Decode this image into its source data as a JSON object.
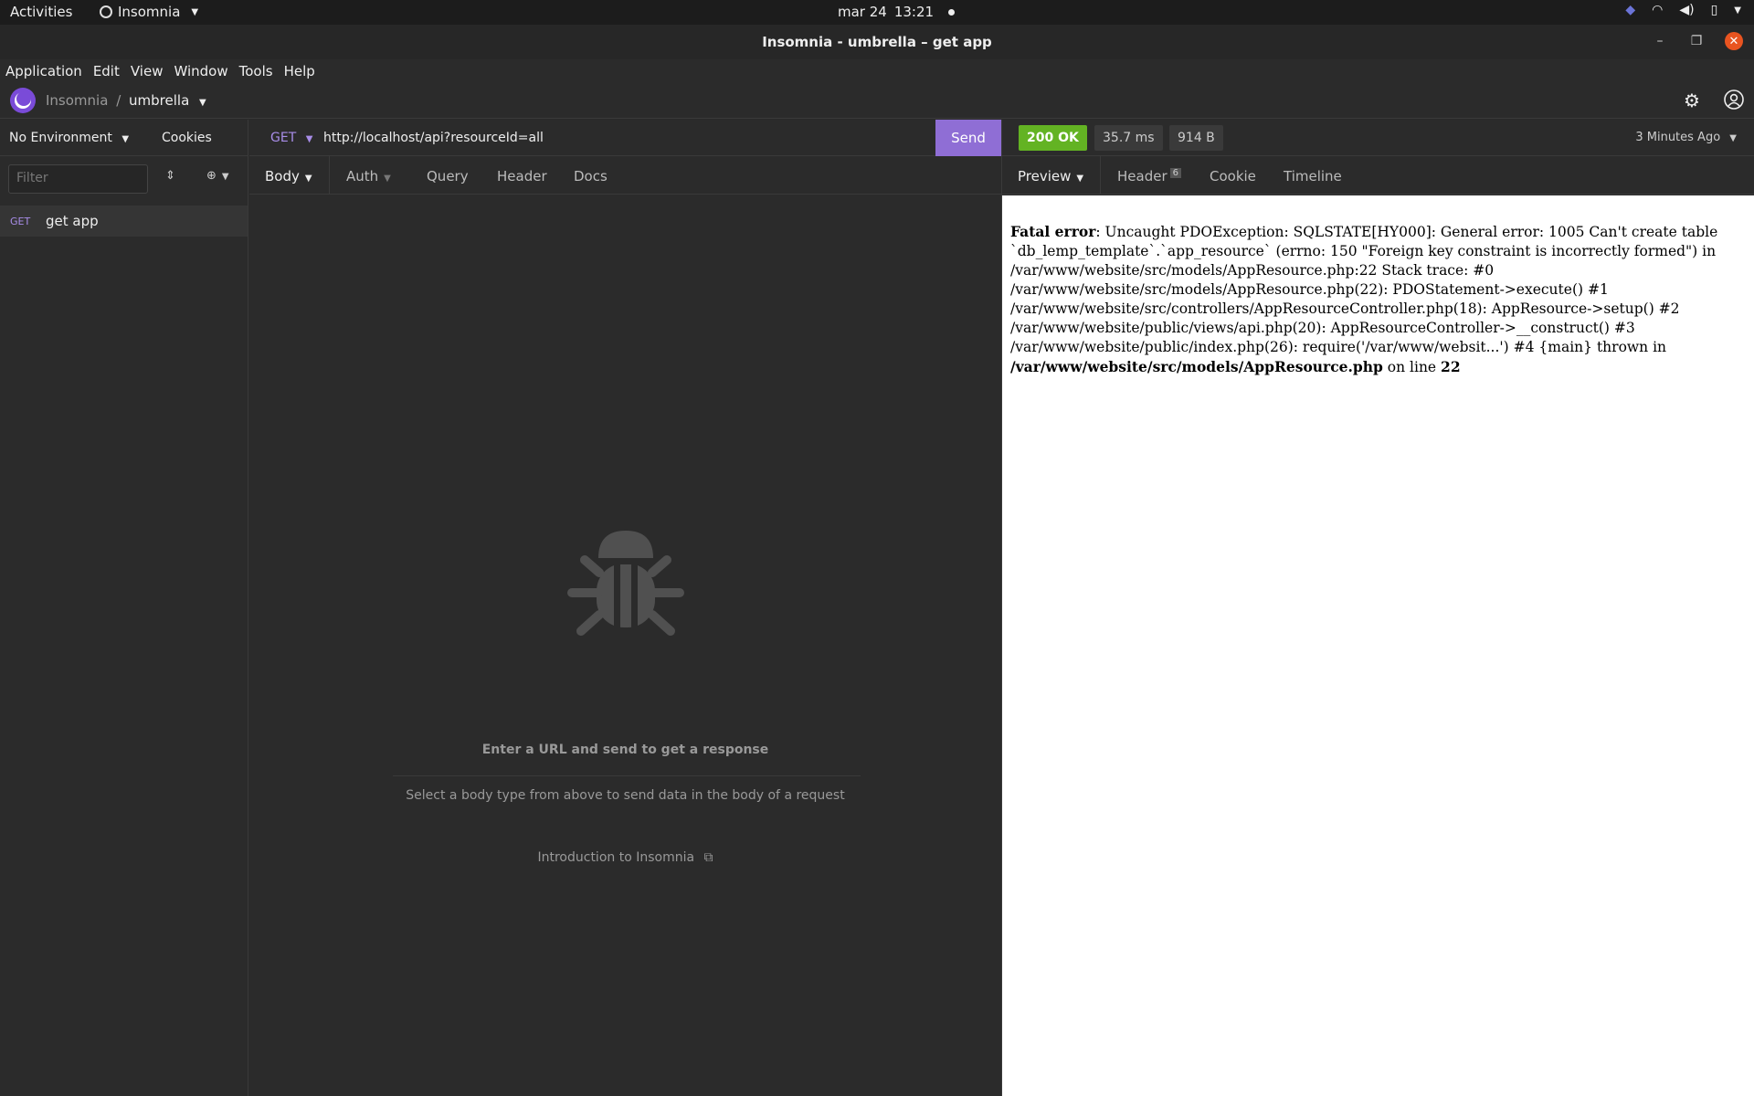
{
  "system_bar": {
    "activities": "Activities",
    "app_name": "Insomnia",
    "date": "mar 24",
    "time": "13:21"
  },
  "window": {
    "title": "Insomnia - umbrella – get app"
  },
  "menu": {
    "items": [
      "Application",
      "Edit",
      "View",
      "Window",
      "Tools",
      "Help"
    ]
  },
  "header": {
    "crumb_root": "Insomnia",
    "crumb_sep": "/",
    "crumb_current": "umbrella"
  },
  "sidebar": {
    "environment": "No Environment",
    "cookies": "Cookies",
    "filter_placeholder": "Filter",
    "requests": [
      {
        "method": "GET",
        "name": "get app"
      }
    ]
  },
  "request": {
    "method": "GET",
    "url": "http://localhost/api?resourceId=all",
    "send_label": "Send",
    "tabs": [
      "Body",
      "Auth",
      "Query",
      "Header",
      "Docs"
    ],
    "empty_title": "Enter a URL and send to get a response",
    "empty_subtitle": "Select a body type from above to send data in the body of a request",
    "intro_link": "Introduction to Insomnia"
  },
  "response": {
    "status": "200 OK",
    "time": "35.7 ms",
    "size": "914 B",
    "age": "3 Minutes Ago",
    "tabs": [
      "Preview",
      "Header",
      "Cookie",
      "Timeline"
    ],
    "header_count": "6",
    "error_label": "Fatal error",
    "error_message": ": Uncaught PDOException: SQLSTATE[HY000]: General error: 1005 Can't create table `db_lemp_template`.`app_resource` (errno: 150 \"Foreign key constraint is incorrectly formed\") in /var/www/website/src/models/AppResource.php:22 Stack trace: #0 /var/www/website/src/models/AppResource.php(22): PDOStatement->execute() #1 /var/www/website/src/controllers/AppResourceController.php(18): AppResource->setup() #2 /var/www/website/public/views/api.php(20): AppResourceController->__construct() #3 /var/www/website/public/index.php(26): require('/var/www/websit...') #4 {main} thrown in",
    "error_file": "/var/www/website/src/models/AppResource.php",
    "error_on_line": "on line",
    "error_line": "22"
  }
}
